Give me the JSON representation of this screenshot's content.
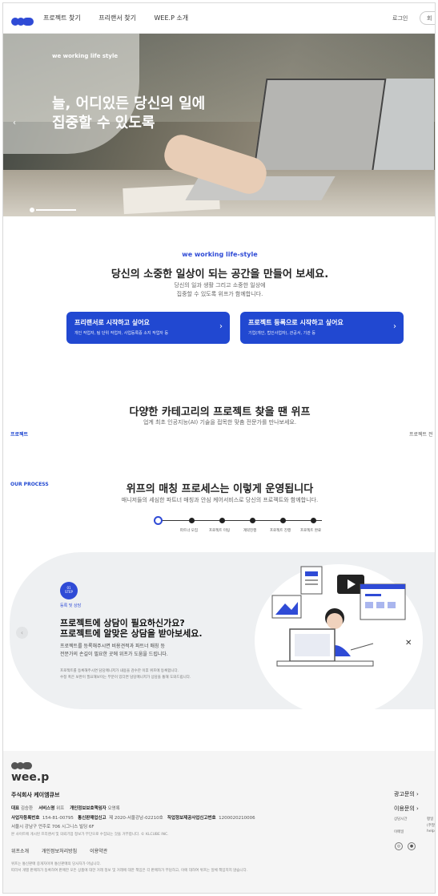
{
  "header": {
    "nav": [
      "프로젝트 찾기",
      "프리랜서 찾기",
      "WEE.P 소개"
    ],
    "login": "로그인",
    "signup": "회"
  },
  "hero": {
    "tag": "we working life style",
    "title": "늘, 어디있든 당신의 일에 집중할 수 있도록",
    "prev_icon": "chevron-left-icon"
  },
  "intro": {
    "eyebrow": "we working life-style",
    "title": "당신의 소중한 일상이 되는 공간을 만들어 보세요.",
    "desc1": "당신의 일과 생활 그리고 소중한 일상에",
    "desc2": "집중할 수 있도록 위프가 함께합니다.",
    "cta_freelancer_title": "프리랜서로 시작하고 싶어요",
    "cta_freelancer_desc": "개인 작업자, 팀 단위 작업자, 사업등록증 소지 작업자 등",
    "cta_project_title": "프로젝트 등록으로 시작하고 싶어요",
    "cta_project_desc": "기업(개인, 법인사업자), 관공서, 기관 등"
  },
  "category": {
    "title": "다양한 카테고리의 프로젝트 찾을 땐 위프",
    "desc": "업계 최초 인공지능(AI) 기술을 접목한 맞춤 전문가를 만나보세요.",
    "label_left": "프로젝트",
    "label_right": "프로젝트 전"
  },
  "process": {
    "eyebrow": "OUR PROCESS",
    "title": "위프의 매칭 프로세스는 이렇게 운영됩니다",
    "desc": "매니저들의 세심한 파트너 매칭과 안심 케어서비스로 당신의 프로젝트와 함께합니다.",
    "steps": [
      "파트너 모집",
      "프로젝트 미팅",
      "계약진행",
      "프로젝트 진행",
      "프로젝트 완료"
    ],
    "badge_num": "01",
    "badge_label": "STEP",
    "step_name": "등록 및 상담",
    "step_title_1": "프로젝트에 상담이 필요하신가요?",
    "step_title_2": "프로젝트에 알맞은 상담을 받아보세요.",
    "step_desc_1": "프로젝트를 등록해주시면 비용견적과 파트너 매칭 등",
    "step_desc_2": "전문가의 손길이 필요한 곳에 위프가 도움을 드립니다.",
    "note_1": "프로젝트를 등록해주시면 담당매니저가 내용을 검수한 이후 위프에 등록합니다.",
    "note_2": "수정 혹은 보완이 필요해보이는 부분이 있다면 담당매니저가 상담을 통해 도와드립니다."
  },
  "footer": {
    "logo_text": "wee.p",
    "company": "주식회사 케이엠큐브",
    "ceo_label": "대표",
    "ceo": "김승환",
    "service_label": "서비스명",
    "service": "위프",
    "privacy_label": "개인정보보호책임자",
    "privacy": "오영록",
    "biz_label": "사업자등록번호",
    "biz": "154-81-00795",
    "ecommerce_label": "통신판매업신고",
    "ecommerce": "제 2020-서울강남-02210호",
    "job_label": "직업정보제공사업신고번호",
    "job": "1200020210006",
    "address": "서울시 강남구 언주로 706 시그니스 빌딩 6F",
    "copyright": "본 사이트에 게시된 프리랜서 및 의뢰기업 정보가 무단으로 수집되는 것을 거부합니다. © KLCUBE INC.",
    "links": [
      "위프소개",
      "개인정보처리방침",
      "이용약관"
    ],
    "notice_1": "위프는 통신판매 중개자이며 통신판매의 당사자가 아닙니다.",
    "notice_2": "따라서 개별 판매자가 등록하여 판매한 모든 상품에 대한 거래 정보 및 거래에 대한 책임은 각 판매자가 부담하고, 이에 대하여 위프는 일체 책임지지 않습니다.",
    "ad": "광고문의",
    "inquiry": "이용문의",
    "hours_label": "상담시간",
    "email_label": "이메일",
    "r1": "평일",
    "r2": "(주말",
    "r3": "help",
    "chevron": "›"
  }
}
